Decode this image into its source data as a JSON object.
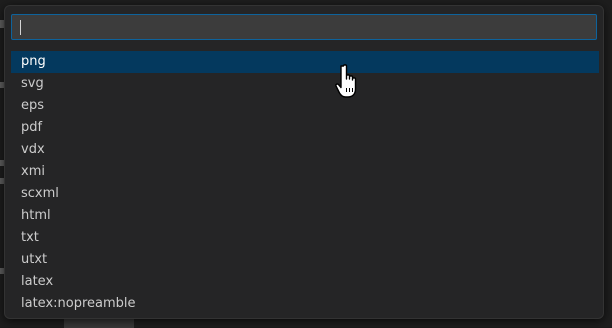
{
  "quick_pick": {
    "input": {
      "value": "",
      "placeholder": ""
    },
    "items": [
      {
        "label": "png",
        "selected": true
      },
      {
        "label": "svg",
        "selected": false
      },
      {
        "label": "eps",
        "selected": false
      },
      {
        "label": "pdf",
        "selected": false
      },
      {
        "label": "vdx",
        "selected": false
      },
      {
        "label": "xmi",
        "selected": false
      },
      {
        "label": "scxml",
        "selected": false
      },
      {
        "label": "html",
        "selected": false
      },
      {
        "label": "txt",
        "selected": false
      },
      {
        "label": "utxt",
        "selected": false
      },
      {
        "label": "latex",
        "selected": false
      },
      {
        "label": "latex:nopreamble",
        "selected": false
      }
    ]
  },
  "colors": {
    "panel_bg": "#252526",
    "input_bg": "#3c3c3c",
    "focus_border": "#0e639c",
    "selected_bg": "#04395e",
    "text": "#cccccc"
  },
  "icons": {
    "pointer": "hand-pointer-icon"
  }
}
